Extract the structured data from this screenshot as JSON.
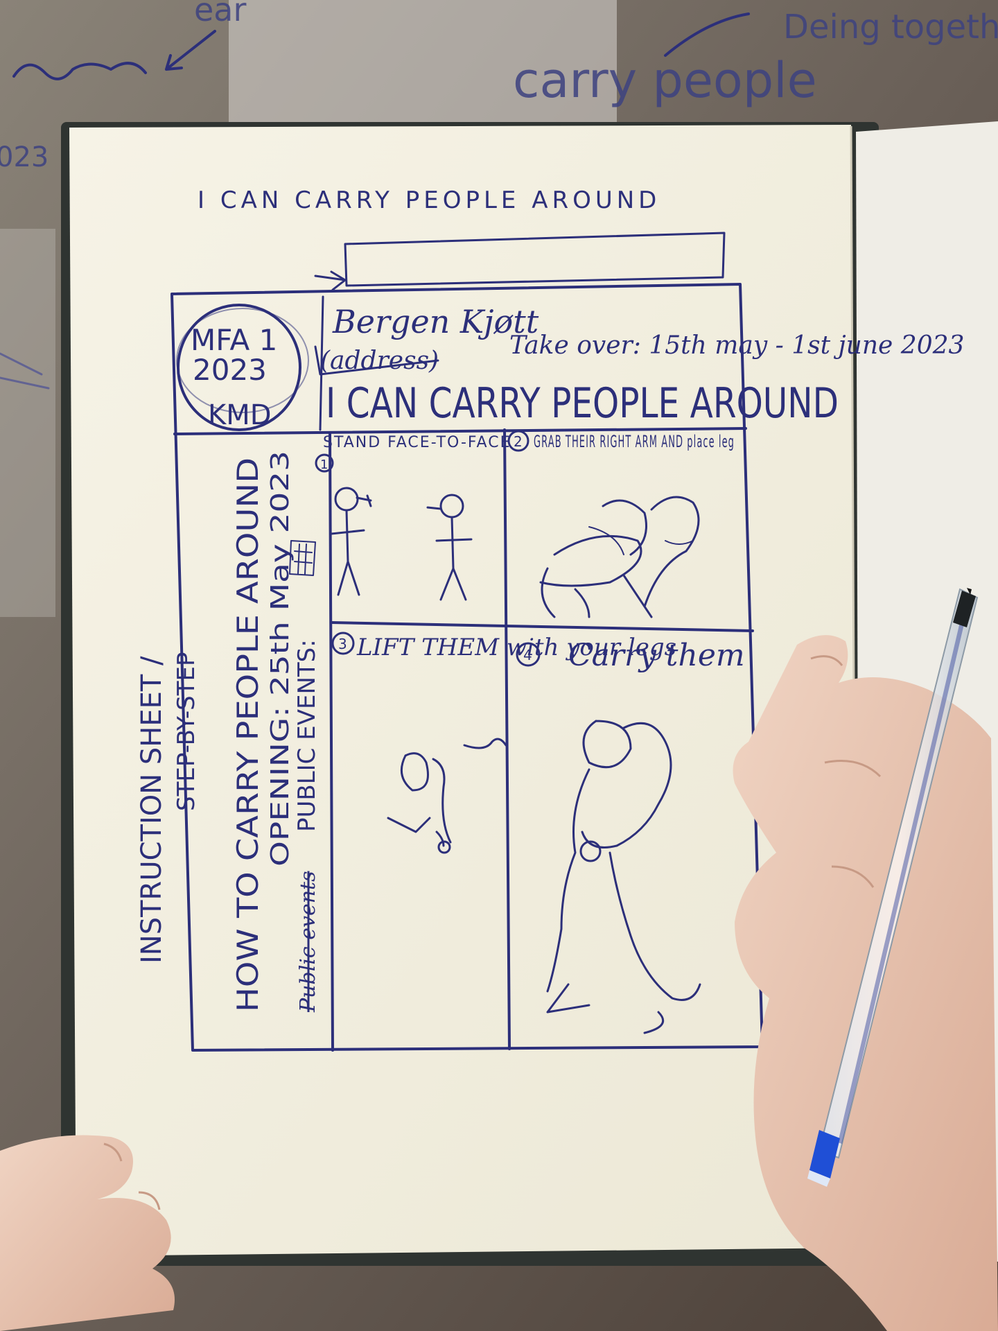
{
  "background_words": {
    "top_left": "ear",
    "center": "carry people",
    "right": "Deing together",
    "left_number": "023"
  },
  "page": {
    "heading": "I CAN CARRY PEOPLE AROUND",
    "sidebar": {
      "line1": "INSTRUCTION SHEET /",
      "line2": "STEP-BY-STEP"
    },
    "poster": {
      "badge_line1": "MFA 1",
      "badge_line2": "2023",
      "badge_line3": "KMD",
      "venue": "Bergen Kjøtt",
      "address": "(address)",
      "takeover": "Take over: 15th may - 1st june 2023",
      "banner": "I CAN CARRY PEOPLE AROUND",
      "vertical_title": "HOW TO CARRY PEOPLE AROUND",
      "vertical_opening": "OPENING: 25th May 2023",
      "vertical_events": "PUBLIC EVENTS:",
      "vertical_struck": "Public events",
      "steps": [
        {
          "num": "1",
          "text": "STAND FACE-TO-FACE"
        },
        {
          "num": "2",
          "text": "GRAB THEIR RIGHT ARM AND place leg"
        },
        {
          "num": "3",
          "text": "LIFT THEM with your legs"
        },
        {
          "num": "4",
          "text": "Carry them"
        }
      ]
    }
  },
  "colors": {
    "ink": "#2c2f7a",
    "paper": "#f3f0e2",
    "table": "#6f6a63",
    "skin": "#e9c9b6",
    "pen_cap": "#1f4fd6"
  }
}
